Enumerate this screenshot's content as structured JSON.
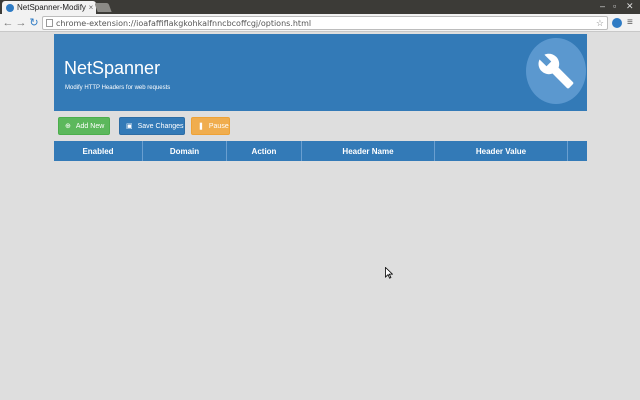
{
  "browser": {
    "tab_title": "NetSpanner-Modify",
    "tab_close": "×",
    "url": "chrome-extension://ioafaffiflakgkohkalfnncbcoffcgj/options.html",
    "back_glyph": "←",
    "forward_glyph": "→",
    "reload_glyph": "↻",
    "star_glyph": "☆",
    "menu_glyph": "≡",
    "window_controls": [
      "–",
      "▫",
      "✕"
    ]
  },
  "header": {
    "title": "NetSpanner",
    "subtitle": "Modify HTTP Headers for web requests",
    "icon": "wrench-icon"
  },
  "actions": {
    "add": {
      "label": "Add New",
      "icon": "plus-circle-icon",
      "glyph": "⊕",
      "color": "#5cb85c"
    },
    "save": {
      "label": "Save Changes",
      "icon": "floppy-disk-icon",
      "glyph": "▣",
      "color": "#337ab7"
    },
    "pause": {
      "label": "Pause",
      "icon": "pause-icon",
      "glyph": "❚",
      "color": "#f0ad4e"
    }
  },
  "table": {
    "columns": [
      "Enabled",
      "Domain",
      "Action",
      "Header Name",
      "Header Value",
      ""
    ]
  },
  "colors": {
    "primary": "#337ab7",
    "page_background": "#dedede"
  }
}
